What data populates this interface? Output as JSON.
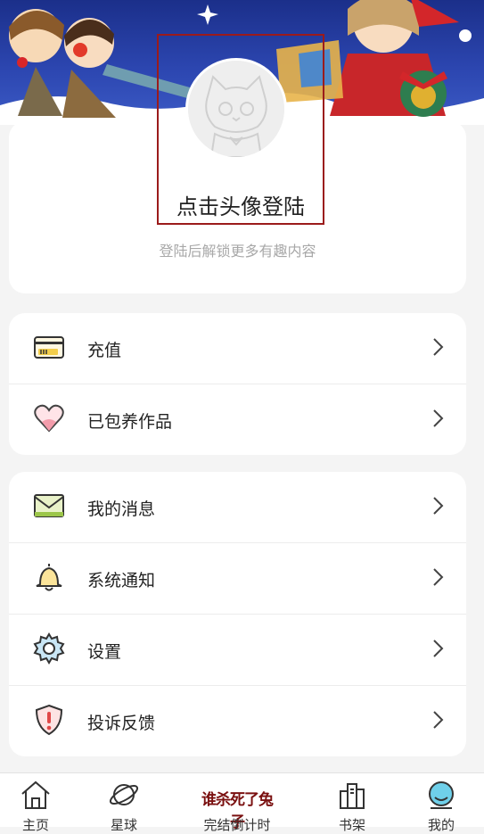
{
  "banner": {
    "alt": "christmas-banner-illustration"
  },
  "profile": {
    "login_title": "点击头像登陆",
    "login_subtitle": "登陆后解锁更多有趣内容"
  },
  "menu_group_1": [
    {
      "label": "充值",
      "icon": "card-icon"
    },
    {
      "label": "已包养作品",
      "icon": "heart-icon"
    }
  ],
  "menu_group_2": [
    {
      "label": "我的消息",
      "icon": "mail-icon"
    },
    {
      "label": "系统通知",
      "icon": "bell-icon"
    },
    {
      "label": "设置",
      "icon": "gear-icon"
    },
    {
      "label": "投诉反馈",
      "icon": "shield-alert-icon"
    }
  ],
  "tabbar": [
    {
      "label": "主页",
      "icon": "home-icon"
    },
    {
      "label": "星球",
      "icon": "planet-icon"
    },
    {
      "label": "完结倒计时",
      "icon": "countdown-logo",
      "logo_text": "谁杀死了兔子"
    },
    {
      "label": "书架",
      "icon": "bookshelf-icon"
    },
    {
      "label": "我的",
      "icon": "profile-icon"
    }
  ],
  "colors": {
    "accent_border": "#9b1b1b",
    "subtitle": "#a8a8a8",
    "banner": "#2c46b0"
  }
}
